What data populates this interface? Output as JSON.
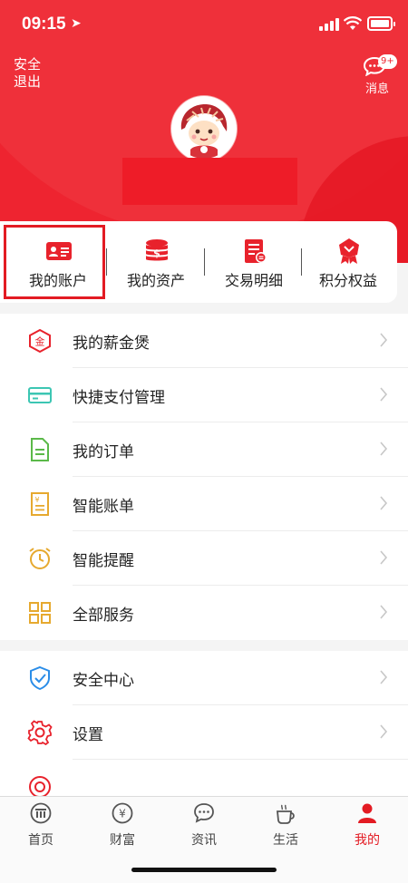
{
  "status_bar": {
    "time": "09:15"
  },
  "header": {
    "logout_label": "安全退出",
    "messages": {
      "label": "消息",
      "badge": "9+"
    }
  },
  "quick_actions": [
    {
      "label": "我的账户",
      "icon": "account-card-icon"
    },
    {
      "label": "我的资产",
      "icon": "coins-icon"
    },
    {
      "label": "交易明细",
      "icon": "transaction-list-icon"
    },
    {
      "label": "积分权益",
      "icon": "points-medal-icon"
    }
  ],
  "menu_group_1": [
    {
      "label": "我的薪金煲",
      "icon": "gold-hexagon-icon",
      "icon_text": "金"
    },
    {
      "label": "快捷支付管理",
      "icon": "bank-card-icon"
    },
    {
      "label": "我的订单",
      "icon": "document-icon"
    },
    {
      "label": "智能账单",
      "icon": "bill-icon"
    },
    {
      "label": "智能提醒",
      "icon": "alarm-clock-icon"
    },
    {
      "label": "全部服务",
      "icon": "grid-icon"
    }
  ],
  "menu_group_2": [
    {
      "label": "安全中心",
      "icon": "shield-check-icon"
    },
    {
      "label": "设置",
      "icon": "gear-icon"
    }
  ],
  "tabbar": [
    {
      "label": "首页",
      "icon": "bank-logo-icon",
      "active": false
    },
    {
      "label": "财富",
      "icon": "yen-coin-icon",
      "active": false
    },
    {
      "label": "资讯",
      "icon": "chat-bubble-icon",
      "active": false
    },
    {
      "label": "生活",
      "icon": "coffee-cup-icon",
      "active": false
    },
    {
      "label": "我的",
      "icon": "person-icon",
      "active": true
    }
  ],
  "colors": {
    "brand_red": "#ee2430",
    "active_tab": "#e31b23",
    "text": "#222222"
  }
}
